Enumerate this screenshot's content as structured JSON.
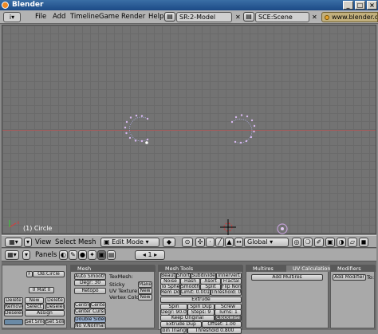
{
  "window": {
    "title": "Blender",
    "minimize": "_",
    "maximize": "□",
    "close": "×"
  },
  "menubar": {
    "items": [
      "File",
      "Add",
      "Timeline",
      "Game",
      "Render",
      "Help"
    ],
    "screen": "SR:2-Model",
    "scene": "SCE:Scene",
    "url": "www.blender.org"
  },
  "viewport": {
    "object_name": "(1) Circle"
  },
  "header3d": {
    "menus": [
      "View",
      "Select",
      "Mesh"
    ],
    "mode": "Edit Mode",
    "orientation": "Global"
  },
  "buttons_header": {
    "panels_label": "Panels",
    "frame": "1"
  },
  "panels": {
    "link": {
      "ob_field": "OB:Circle",
      "f_label": "F",
      "mat_field": "0 Mat 0",
      "delete": "Delete",
      "new": "New",
      "remove": "Remove",
      "select": "Select",
      "deselect": "Deselect",
      "assign": "Assign",
      "set_smooth": "Set Smooth",
      "set_solid": "Set Solid"
    },
    "mesh": {
      "title": "Mesh",
      "auto_smooth": "Auto Smooth",
      "degr": "Degr: 30",
      "retopo": "Retopo",
      "texmesh": "TexMesh:",
      "sticky": "Sticky",
      "uv_texture": "UV Texture",
      "vertex_color": "Vertex Color",
      "make": "Make",
      "new1": "New",
      "new2": "New",
      "centre": "Centre",
      "center_new": "Center New",
      "center_cursor": "Center Cursor",
      "double_sided": "Double Sided",
      "no_v_normal_flip": "No V.Normal Flip"
    },
    "mesh_tools": {
      "title": "Mesh Tools",
      "beauty": "Beauty",
      "short": "Short",
      "subdivide": "Subdivide",
      "innervert": "Innervert",
      "noise": "Noise",
      "hash": "Hash",
      "xsort": "Xsort",
      "fractal": "Fractal",
      "to_sphere": "To Sphere",
      "smooth": "Smooth",
      "split": "Split",
      "flip_normals": "Flip Normals",
      "rem_doubles": "Rem Doubles",
      "limit": "Limit: 0.001",
      "threshold": "Threshold: 0.010",
      "extrude": "Extrude",
      "spin": "Spin",
      "spin_dup": "Spin Dup",
      "screw": "Screw",
      "degr": "Degr: 90.00",
      "steps": "Steps: 9",
      "turns": "Turns: 1",
      "keep_original": "Keep Original",
      "clockwise": "Clockwise",
      "extrude_dup": "Extrude Dup",
      "offset": "Offset: 1.00",
      "join_triangles": "Join Triangles",
      "threshold2": "Threshold 0.800"
    },
    "multires": {
      "title": "Multires",
      "tab2": "UV Calculation",
      "add": "Add Multires"
    },
    "modifiers": {
      "title": "Modifiers",
      "add": "Add Modifier",
      "to": "To:"
    }
  },
  "colors": {
    "accent": "#3a6ea5",
    "vertex": "#c3a0d8",
    "cursor_red": "#d83030"
  }
}
